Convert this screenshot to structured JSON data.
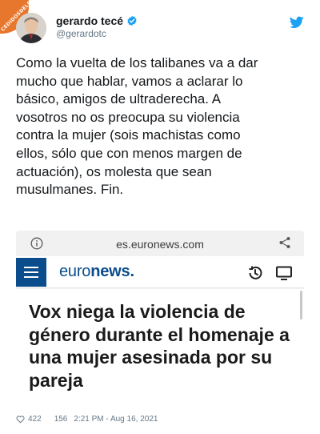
{
  "watermark": {
    "text": "CEDIDOSDELDIA"
  },
  "user": {
    "name": "gerardo tecé",
    "handle": "@gerardotc"
  },
  "tweet": {
    "text": "Como la vuelta de los talibanes va a dar\nmucho que hablar, vamos a aclarar lo\nbásico, amigos de ultraderecha. A\nvosotros no os preocupa su violencia\ncontra la mujer (sois machistas como\nellos, sólo que con menos margen de\nactuación), os molesta que sean\nmusulmanes. Fin."
  },
  "embed": {
    "url": "es.euronews.com",
    "logo_prefix": "euro",
    "logo_bold": "news",
    "logo_dot": ".",
    "headline": "Vox niega la violencia de género durante el homenaje a una mujer asesinada por su pareja"
  },
  "footer": {
    "likes": "422",
    "retweets": "156",
    "timestamp": "2:21 PM - Aug 16, 2021"
  },
  "colors": {
    "brand_blue": "#0b4c8c",
    "twitter_blue": "#1da1f2",
    "watermark_orange": "#e8772e"
  },
  "icons": [
    "info-icon",
    "share-icon",
    "menu-icon",
    "clock-icon",
    "tv-icon",
    "heart-icon",
    "verified-icon",
    "twitter-bird-icon"
  ]
}
